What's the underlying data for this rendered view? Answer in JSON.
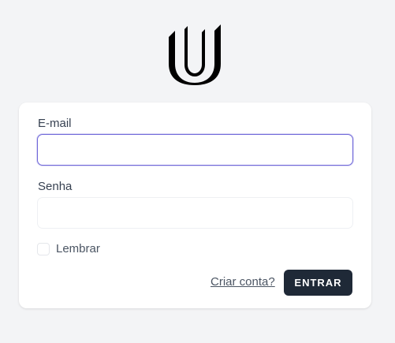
{
  "logo": {
    "icon": "u-logo-icon"
  },
  "form": {
    "email_label": "E-mail",
    "email_value": "",
    "email_placeholder": "",
    "password_label": "Senha",
    "password_value": "",
    "password_placeholder": "",
    "remember_label": "Lembrar",
    "create_account_label": "Criar conta?",
    "submit_label": "ENTRAR"
  },
  "colors": {
    "background": "#f3f4f6",
    "card": "#ffffff",
    "focus_border": "#6f67d9",
    "button": "#1f2937"
  }
}
